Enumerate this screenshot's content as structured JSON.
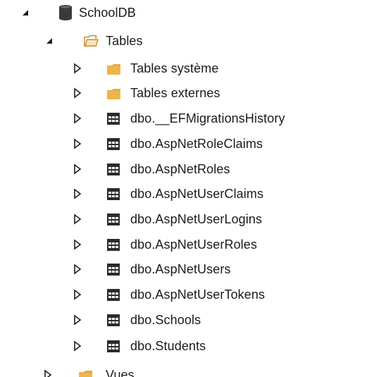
{
  "tree": {
    "database": {
      "label": "SchoolDB",
      "expanded": true
    },
    "tables": {
      "label": "Tables",
      "expanded": true
    },
    "children": [
      {
        "label": "Tables système",
        "icon": "folder-icon"
      },
      {
        "label": "Tables externes",
        "icon": "folder-icon"
      },
      {
        "label": "dbo.__EFMigrationsHistory",
        "icon": "table-icon"
      },
      {
        "label": "dbo.AspNetRoleClaims",
        "icon": "table-icon"
      },
      {
        "label": "dbo.AspNetRoles",
        "icon": "table-icon"
      },
      {
        "label": "dbo.AspNetUserClaims",
        "icon": "table-icon"
      },
      {
        "label": "dbo.AspNetUserLogins",
        "icon": "table-icon"
      },
      {
        "label": "dbo.AspNetUserRoles",
        "icon": "table-icon"
      },
      {
        "label": "dbo.AspNetUsers",
        "icon": "table-icon"
      },
      {
        "label": "dbo.AspNetUserTokens",
        "icon": "table-icon"
      },
      {
        "label": "dbo.Schools",
        "icon": "table-icon"
      },
      {
        "label": "dbo.Students",
        "icon": "table-icon"
      }
    ],
    "views": {
      "label": "Vues",
      "expanded": false
    }
  },
  "colors": {
    "folder": "#e8a93b",
    "folder_open_outline": "#c5882c",
    "database": "#3a3a3a",
    "table": "#2b2b2b",
    "arrow": "#1e1e1e"
  }
}
